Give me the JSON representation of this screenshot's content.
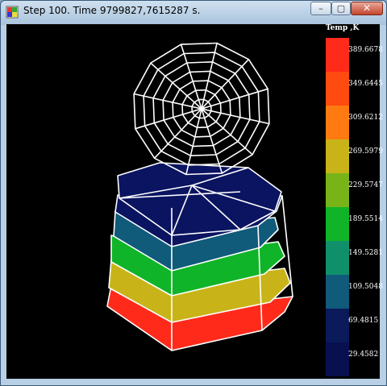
{
  "window": {
    "title": "Step 100. Time 9799827,7615287 s.",
    "controls": {
      "minimize": "–",
      "maximize": "▢",
      "close": "✕"
    }
  },
  "legend": {
    "title": "Temp ,K",
    "items": [
      {
        "label": "389.6678",
        "color": "#ff2a1a"
      },
      {
        "label": "349.6445",
        "color": "#ff4a10"
      },
      {
        "label": "309.6212",
        "color": "#ff7a10"
      },
      {
        "label": "269.5979",
        "color": "#c8b418"
      },
      {
        "label": "229.5747",
        "color": "#78b418"
      },
      {
        "label": "189.5514",
        "color": "#10b428"
      },
      {
        "label": "149.5281",
        "color": "#10906a"
      },
      {
        "label": "109.5048",
        "color": "#105a7a"
      },
      {
        "label": "69.4815",
        "color": "#0a1a5a"
      },
      {
        "label": "29.4582",
        "color": "#081050"
      }
    ]
  },
  "colors": {
    "background": "#000000",
    "wireframe": "#ffffff",
    "top_blue": "#0a1460"
  }
}
